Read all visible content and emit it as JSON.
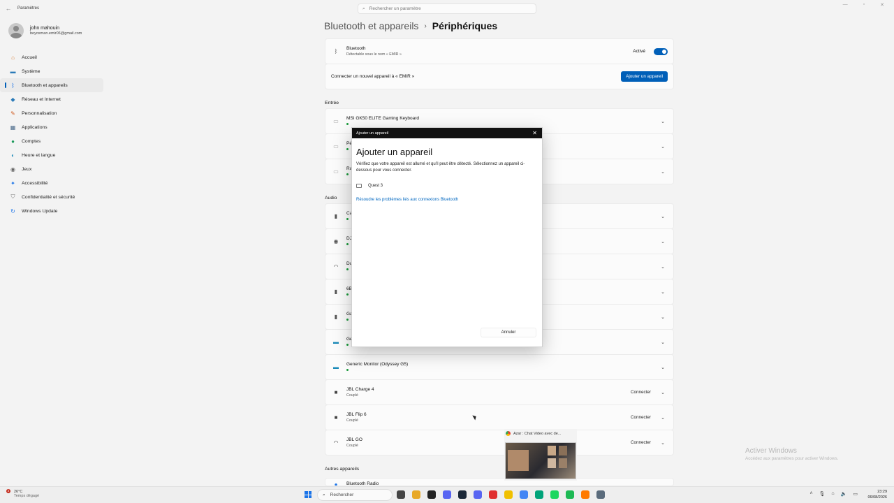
{
  "window": {
    "title": "Paramètres"
  },
  "search": {
    "placeholder": "Rechercher un paramètre"
  },
  "user": {
    "name": "john mahouin",
    "email": "beyosman.emir06@gmail.com"
  },
  "sidebar": {
    "items": [
      {
        "label": "Accueil",
        "icon": "home-icon",
        "color": "#d87a2e"
      },
      {
        "label": "Système",
        "icon": "monitor-icon",
        "color": "#2a7ab8"
      },
      {
        "label": "Bluetooth et appareils",
        "icon": "bluetooth-icon",
        "color": "#1a73e8",
        "active": true
      },
      {
        "label": "Réseau et Internet",
        "icon": "wifi-icon",
        "color": "#2a7ab8"
      },
      {
        "label": "Personnalisation",
        "icon": "brush-icon",
        "color": "#d05a20"
      },
      {
        "label": "Applications",
        "icon": "apps-icon",
        "color": "#4a6a8a"
      },
      {
        "label": "Comptes",
        "icon": "person-icon",
        "color": "#1a9a5a"
      },
      {
        "label": "Heure et langue",
        "icon": "globe-icon",
        "color": "#1a8ab8"
      },
      {
        "label": "Jeux",
        "icon": "gamepad-icon",
        "color": "#666666"
      },
      {
        "label": "Accessibilité",
        "icon": "accessibility-icon",
        "color": "#1a73e8"
      },
      {
        "label": "Confidentialité et sécurité",
        "icon": "shield-icon",
        "color": "#777777"
      },
      {
        "label": "Windows Update",
        "icon": "update-icon",
        "color": "#1a73e8"
      }
    ]
  },
  "breadcrumb": {
    "parent": "Bluetooth et appareils",
    "current": "Périphériques"
  },
  "bluetooth": {
    "title": "Bluetooth",
    "subtitle": "Détectable sous le nom « EMIR »",
    "state": "Activé"
  },
  "add_device": {
    "text": "Connecter un nouvel appareil à « EMIR »",
    "button": "Ajouter un appareil"
  },
  "sections": {
    "input": "Entrée",
    "audio": "Audio",
    "other": "Autres appareils"
  },
  "input_devices": [
    {
      "name": "MSI GK50 ELITE Gaming Keyboard"
    },
    {
      "name": "Pé"
    },
    {
      "name": "Ra"
    }
  ],
  "audio_devices": [
    {
      "name": "Ca",
      "icon": "speaker-icon"
    },
    {
      "name": "DJ",
      "icon": "webcam-icon"
    },
    {
      "name": "Du",
      "icon": "headset-icon"
    },
    {
      "name": "6B",
      "icon": "speaker-icon"
    },
    {
      "name": "Ga",
      "icon": "speaker-icon"
    },
    {
      "name": "Ge",
      "icon": "monitor-icon"
    }
  ],
  "monitor_device": {
    "name": "Generic Monitor (Odyssey G5)"
  },
  "paired_devices": [
    {
      "name": "JBL Charge 4",
      "status": "Couplé",
      "action": "Connecter"
    },
    {
      "name": "JBL Flip 6",
      "status": "Couplé",
      "action": "Connecter"
    },
    {
      "name": "JBL GO",
      "status": "Couplé",
      "action": "Connecter"
    }
  ],
  "other_devices": [
    {
      "name": "Bluetooth Radio"
    }
  ],
  "dialog": {
    "header": "Ajouter un appareil",
    "title": "Ajouter un appareil",
    "text": "Vérifiez que votre appareil est allumé et qu'il peut être détecté. Sélectionnez un appareil ci-dessous pour vous connecter.",
    "device": "Quest 3",
    "link": "Résoudre les problèmes liés aux connexions Bluetooth",
    "cancel": "Annuler"
  },
  "pip": {
    "title": "Azar : Chat Video avec de..."
  },
  "watermark": {
    "line1": "Activer Windows",
    "line2": "Accédez aux paramètres pour activer Windows."
  },
  "taskbar": {
    "weather_temp": "26°C",
    "weather_desc": "Temps dégagé",
    "weather_badge": "2",
    "search": "Rechercher",
    "apps": [
      "#444444",
      "#e8a826",
      "#222222",
      "#5865f2",
      "#1b2838",
      "#5865f2",
      "#e03030",
      "#f0c000",
      "#4285f4",
      "#00a37a",
      "#1ed760",
      "#1db954",
      "#ff7a00",
      "#5a6b7b"
    ],
    "time": "23:29",
    "date": "06/08/2026"
  }
}
